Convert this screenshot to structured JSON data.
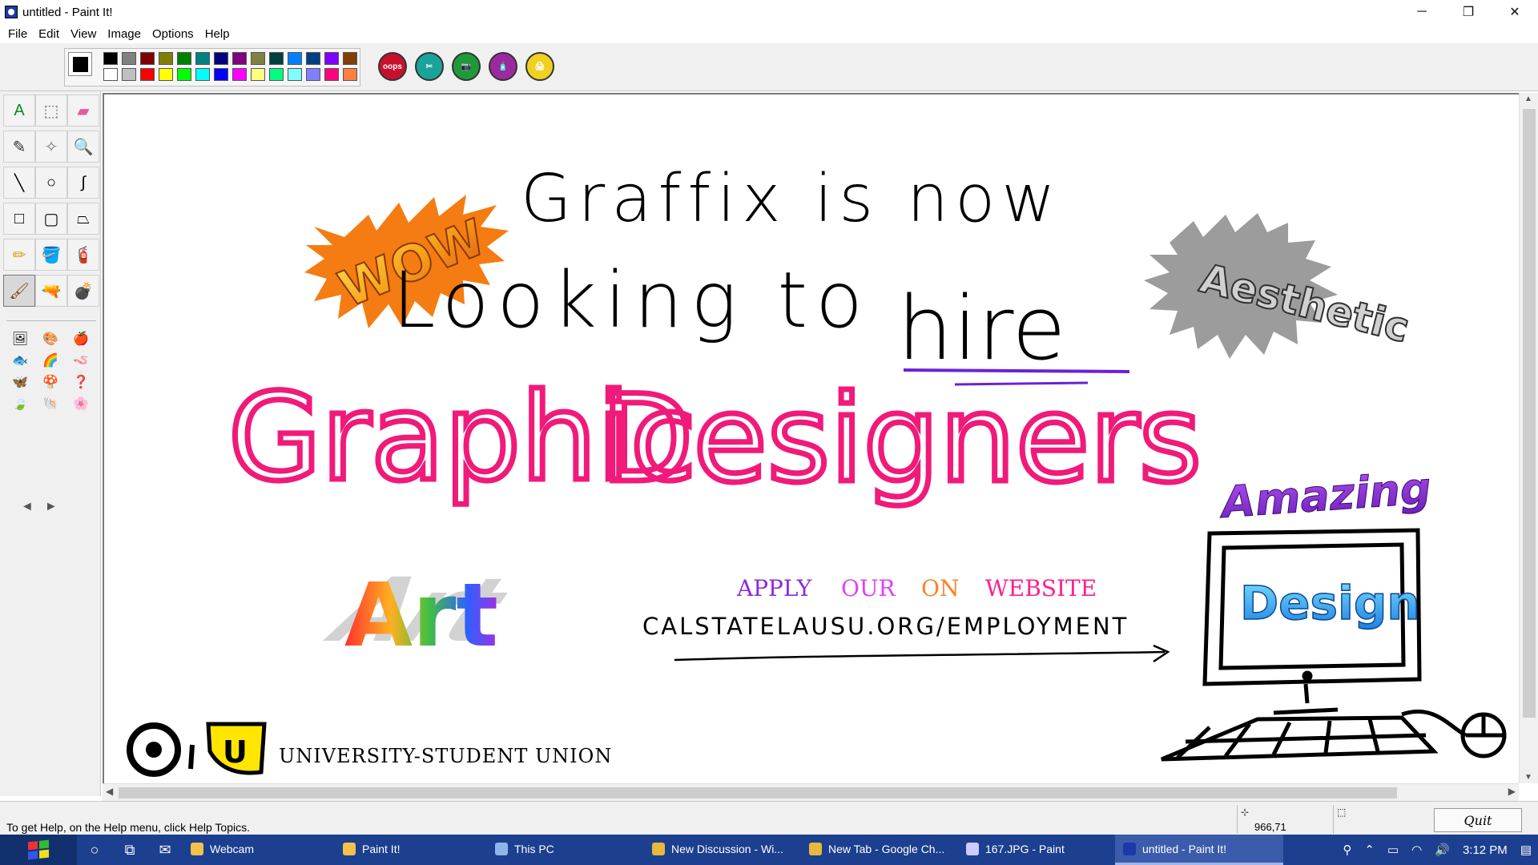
{
  "window": {
    "title": "untitled - Paint It!",
    "minimize": "─",
    "maximize": "❐",
    "close": "✕"
  },
  "menu": [
    "File",
    "Edit",
    "View",
    "Image",
    "Options",
    "Help"
  ],
  "palette": {
    "current": "#000000",
    "colors": [
      "#000000",
      "#808080",
      "#800000",
      "#808000",
      "#008000",
      "#008080",
      "#000080",
      "#800080",
      "#808040",
      "#004040",
      "#0080ff",
      "#004080",
      "#8000ff",
      "#804000",
      "#ffffff",
      "#c0c0c0",
      "#ff0000",
      "#ffff00",
      "#00ff00",
      "#00ffff",
      "#0000ff",
      "#ff00ff",
      "#ffff80",
      "#00ff80",
      "#80ffff",
      "#8080ff",
      "#ff0080",
      "#ff8040"
    ]
  },
  "actions": [
    {
      "name": "oops-button",
      "label": "oops",
      "color": "#c8102e"
    },
    {
      "name": "scissors-button",
      "label": "✂",
      "color": "#1aa39a"
    },
    {
      "name": "camera-button",
      "label": "📷",
      "color": "#1f9a3a"
    },
    {
      "name": "paint-bottle-button",
      "label": "🧴",
      "color": "#9b2aa0"
    },
    {
      "name": "printer-button",
      "label": "🖨",
      "color": "#f0d020"
    }
  ],
  "tools": [
    {
      "name": "text-tool-icon",
      "glyph": "A",
      "color": "#0a8a2a"
    },
    {
      "name": "rect-select-tool-icon",
      "glyph": "⬚",
      "color": "#666"
    },
    {
      "name": "eraser-tool-icon",
      "glyph": "▰",
      "color": "#e0609a"
    },
    {
      "name": "eyedropper-tool-icon",
      "glyph": "✎",
      "color": "#333"
    },
    {
      "name": "free-select-tool-icon",
      "glyph": "✧",
      "color": "#777"
    },
    {
      "name": "magnifier-tool-icon",
      "glyph": "🔍",
      "color": "#b8860b"
    },
    {
      "name": "line-tool-icon",
      "glyph": "╲",
      "color": "#000"
    },
    {
      "name": "ellipse-tool-icon",
      "glyph": "○",
      "color": "#000"
    },
    {
      "name": "curve-tool-icon",
      "glyph": "∫",
      "color": "#000"
    },
    {
      "name": "rectangle-tool-icon",
      "glyph": "□",
      "color": "#000"
    },
    {
      "name": "rounded-rect-tool-icon",
      "glyph": "▢",
      "color": "#000"
    },
    {
      "name": "polygon-tool-icon",
      "glyph": "⏢",
      "color": "#000"
    },
    {
      "name": "pencil-tool-icon",
      "glyph": "✏",
      "color": "#d4a017"
    },
    {
      "name": "paint-bucket-tool-icon",
      "glyph": "🪣",
      "color": "#2060c0"
    },
    {
      "name": "spray-can-tool-icon",
      "glyph": "🧯",
      "color": "#30a030"
    },
    {
      "name": "brush-tool-icon",
      "glyph": "🖌",
      "color": "#8b4513"
    },
    {
      "name": "airbrush-tool-icon",
      "glyph": "🔫",
      "color": "#c8a000"
    },
    {
      "name": "bomb-tool-icon",
      "glyph": "💣",
      "color": "#000"
    }
  ],
  "stamps": [
    "🖼",
    "🎨",
    "🍎",
    "🐟",
    "🌈",
    "🪱",
    "🦋",
    "🍄",
    "❓",
    "🍃",
    "🐚",
    "🌸"
  ],
  "canvas": {
    "wow_burst": "WOW",
    "headline_1": "Graffix is now",
    "headline_2": "Looking to",
    "headline_hire": "hire",
    "headline_graphic": "Graphic",
    "headline_designers": "Designers",
    "aesthetic_burst": "Aesthetic",
    "amazing": "Amazing",
    "design_screen": "Design",
    "art": "Art",
    "apply_words": [
      {
        "text": "APPLY",
        "color": "#8a2be2"
      },
      {
        "text": "OUR",
        "color": "#e040fb"
      },
      {
        "text": "ON",
        "color": "#ff7f27"
      },
      {
        "text": "WEBSITE",
        "color": "#ff1f8e"
      }
    ],
    "url": "CALSTATELAUSU.ORG/EMPLOYMENT",
    "logo_initials": "U",
    "union_name": "UNIVERSITY-STUDENT UNION"
  },
  "status": {
    "help": "To get Help, on the Help menu, click Help Topics.",
    "coords": "966,71",
    "quit": "Quit"
  },
  "taskbar": {
    "tasks": [
      {
        "label": "Webcam",
        "color": "#f3c24d",
        "active": false
      },
      {
        "label": "Paint It!",
        "color": "#f3c24d",
        "active": false
      },
      {
        "label": "This PC",
        "color": "#8fb5e8",
        "active": false
      },
      {
        "label": "New Discussion - Wi...",
        "color": "#e6b93a",
        "active": false
      },
      {
        "label": "New Tab - Google Ch...",
        "color": "#e6b93a",
        "active": false
      },
      {
        "label": "167.JPG - Paint",
        "color": "#ccccff",
        "active": false
      },
      {
        "label": "untitled - Paint It!",
        "color": "#1b3aa8",
        "active": true
      }
    ],
    "time": "3:12 PM"
  }
}
